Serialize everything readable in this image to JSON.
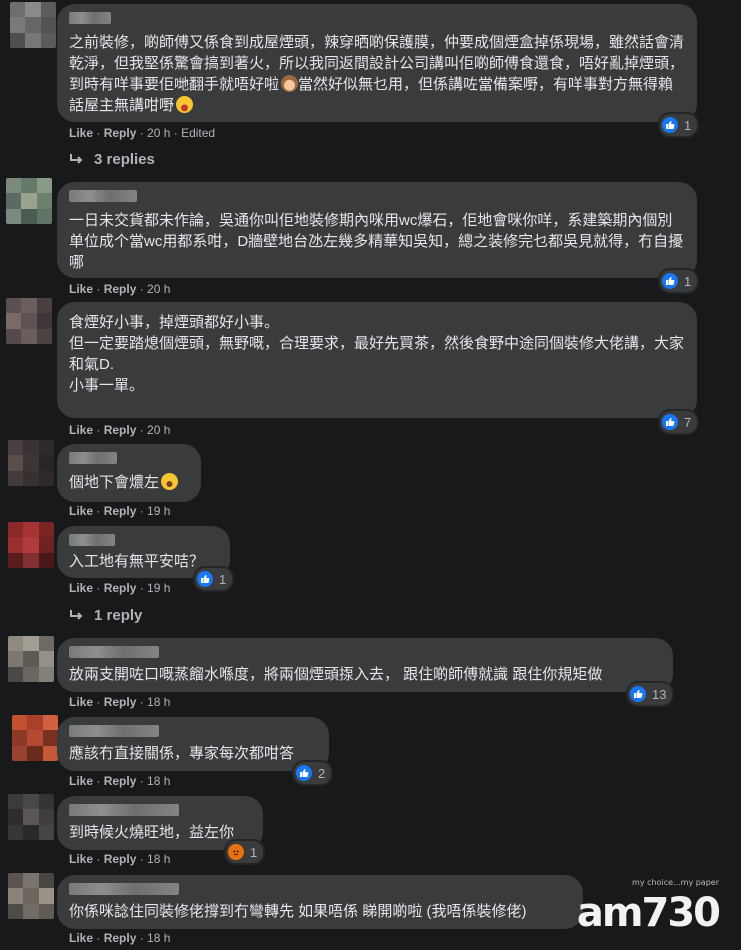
{
  "comments": [
    {
      "text": "之前裝修，啲師傅又係食到成屋煙頭，辣穿晒啲保護膜，仲要成個煙盒掉係現場，雖然話會清乾淨，但我堅係驚會搞到著火，所以我同返間設計公司講叫佢啲師傅食還食，唔好亂掉煙頭，到時有咩事要佢哋翻手就唔好啦",
      "text_tail": "當然好似無乜用，但係講咗當備案嘢，有咩事對方無得賴話屋主無講咁嘢",
      "emoji1": "monkey-emoji-icon",
      "emoji2": "grin-emoji-icon",
      "like": "Like",
      "reply": "Reply",
      "time": "20 h",
      "edited": "Edited",
      "reaction_count": "1",
      "replies_label": "3 replies"
    },
    {
      "text": "一日未交貨都未作論，吳通你叫佢地裝修期內咪用wc爆石，佢地會咪你咩，系建築期內個別单位成个當wc用都系咁，D牆壁地台氹左幾多精華知吳知，總之装修完乜都吳見就得，冇自擾哪",
      "like": "Like",
      "reply": "Reply",
      "time": "20 h",
      "reaction_count": "1"
    },
    {
      "text": "食煙好小事，掉煙頭都好小事。\n但一定要踏熄個煙頭，無野嘅，合理要求，最好先買茶，然後食野中途同個裝修大佬講，大家和氣D.\n小事一單。",
      "like": "Like",
      "reply": "Reply",
      "time": "20 h",
      "reaction_count": "7"
    },
    {
      "text": "個地下會燶左",
      "emoji1": "laugh-emoji-icon",
      "like": "Like",
      "reply": "Reply",
      "time": "19 h"
    },
    {
      "text": "入工地有無平安咭？",
      "like": "Like",
      "reply": "Reply",
      "time": "19 h",
      "reaction_count": "1",
      "replies_label": "1 reply"
    },
    {
      "text": "放兩支開咗口嘅蒸餾水喺度，將兩個煙頭揼入去， 跟住啲師傅就識 跟住你規矩做",
      "like": "Like",
      "reply": "Reply",
      "time": "18 h",
      "reaction_count": "13"
    },
    {
      "text": "應該冇直接關係，專家每次都咁答",
      "like": "Like",
      "reply": "Reply",
      "time": "18 h",
      "reaction_count": "2"
    },
    {
      "text": "到時候火燒旺地，益左你",
      "like": "Like",
      "reply": "Reply",
      "time": "18 h",
      "reaction_count": "1"
    },
    {
      "text": "你係咪諗住同裝修佬撐到冇彎轉先 如果唔係 睇開啲啦 (我唔係裝修佬)",
      "like": "Like",
      "reply": "Reply",
      "time": "18 h"
    }
  ],
  "watermark": {
    "brand": "am730",
    "tagline": "my choice...my paper"
  },
  "colors": {
    "like_blue": "#1877f2",
    "angry_orange": "#e9710f",
    "bubble": "#3a3b3c",
    "bg": "#18191a"
  }
}
